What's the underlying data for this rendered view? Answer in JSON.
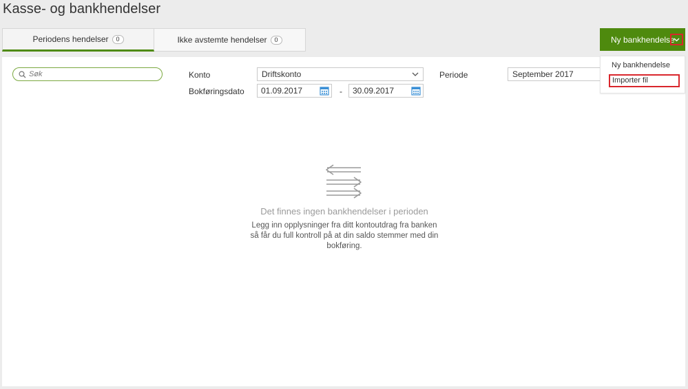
{
  "page": {
    "title": "Kasse- og bankhendelser"
  },
  "tabs": [
    {
      "label": "Periodens hendelser",
      "count": "0"
    },
    {
      "label": "Ikke avstemte hendelser",
      "count": "0"
    }
  ],
  "new_button": {
    "label": "Ny bankhendelse",
    "menu": [
      "Ny bankhendelse",
      "Importer fil"
    ]
  },
  "search": {
    "placeholder": "Søk"
  },
  "filters": {
    "konto_label": "Konto",
    "konto_value": "Driftskonto",
    "periode_label": "Periode",
    "periode_value": "September 2017",
    "date_label": "Bokføringsdato",
    "date_from": "01.09.2017",
    "date_to": "30.09.2017",
    "date_separator": "-"
  },
  "empty_state": {
    "title": "Det finnes ingen bankhendelser i perioden",
    "description": "Legg inn opplysninger fra ditt kontoutdrag fra banken så får du full kontroll på at din saldo stemmer med din bokføring."
  },
  "colors": {
    "accent": "#4e8a0e",
    "highlight": "#d9262c",
    "calendar": "#3a8fd6"
  },
  "icons": [
    "search-icon",
    "chevron-down-icon",
    "calendar-icon",
    "transfer-arrows-icon"
  ]
}
